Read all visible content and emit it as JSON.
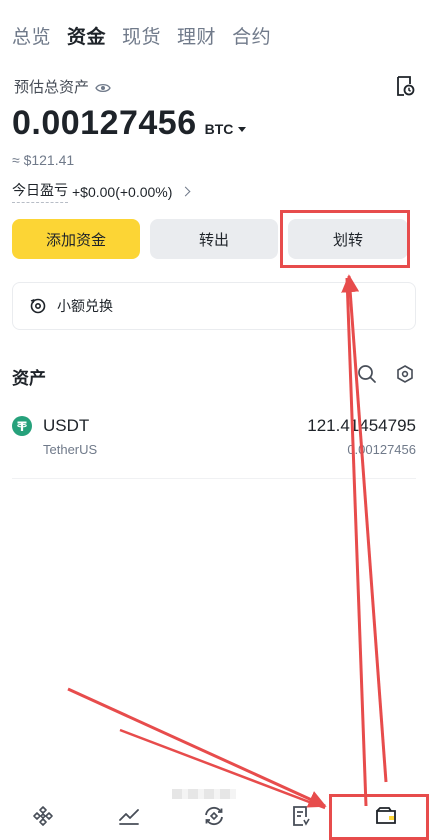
{
  "tabs": [
    {
      "label": "总览",
      "active": false
    },
    {
      "label": "资金",
      "active": true
    },
    {
      "label": "现货",
      "active": false
    },
    {
      "label": "理财",
      "active": false
    },
    {
      "label": "合约",
      "active": false
    }
  ],
  "overview": {
    "estimated_label": "预估总资产",
    "balance": "0.00127456",
    "currency": "BTC",
    "fiat_value": "≈ $121.41",
    "pnl_label": "今日盈亏",
    "pnl_value": "+$0.00(+0.00%)"
  },
  "actions": {
    "deposit": "添加资金",
    "withdraw": "转出",
    "transfer": "划转"
  },
  "convert": {
    "label": "小额兑换"
  },
  "assets": {
    "title": "资产",
    "items": [
      {
        "symbol": "USDT",
        "name": "TetherUS",
        "amount": "121.41454795",
        "btc_value": "0.00127456"
      }
    ]
  },
  "bottom_nav": [
    {
      "icon": "home-icon"
    },
    {
      "icon": "markets-icon"
    },
    {
      "icon": "trade-icon"
    },
    {
      "icon": "orders-icon"
    },
    {
      "icon": "wallet-icon",
      "active": true
    }
  ],
  "colors": {
    "brand_yellow": "#fcd535",
    "annotation_red": "#e74c4c",
    "tether_green": "#26a17b"
  }
}
